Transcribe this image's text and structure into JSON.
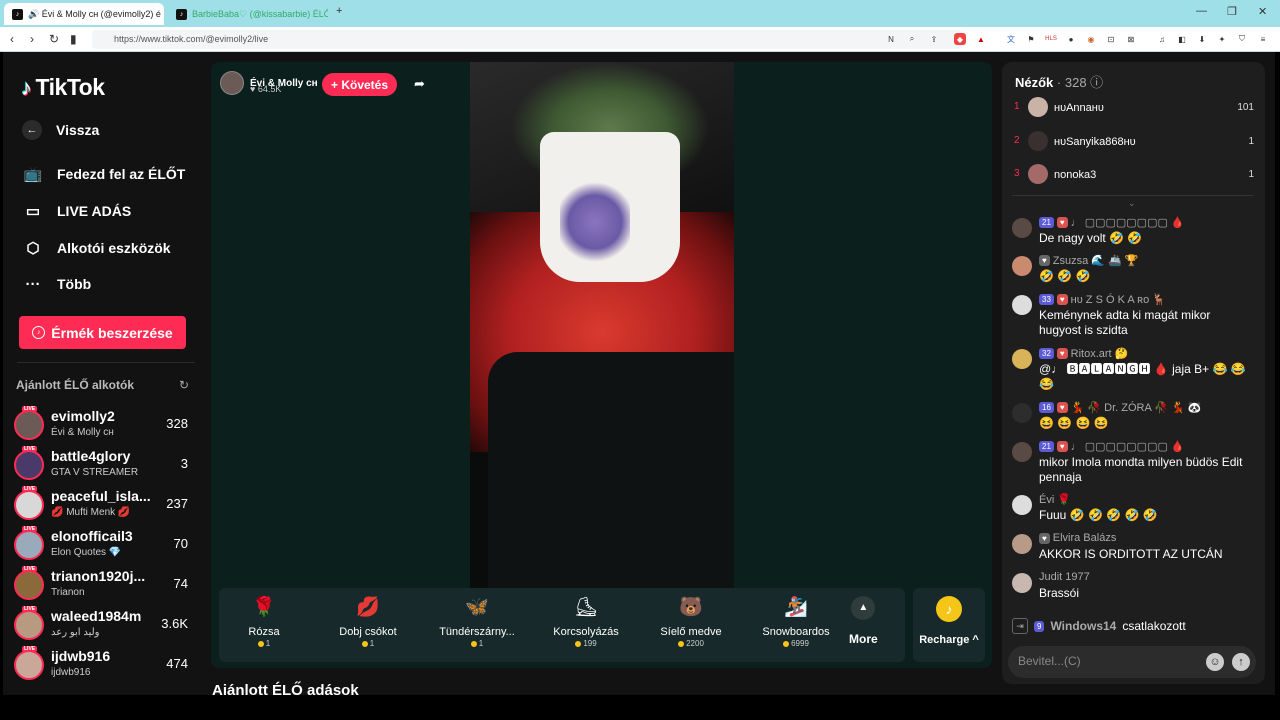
{
  "browser": {
    "tabs": [
      {
        "title": "🔊 Évi & Molly ᴄʜ (@evimolly2) é"
      },
      {
        "title": "BarbieBaba♡ (@kissabarbie) ÉLŐ ad"
      }
    ],
    "url": "https://www.tiktok.com/@evimolly2/live"
  },
  "sidebar": {
    "logo": "TikTok",
    "back": "Vissza",
    "nav": [
      {
        "label": "Fedezd fel az ÉLŐT",
        "icon": "tv-icon"
      },
      {
        "label": "LIVE ADÁS",
        "icon": "camera-icon"
      },
      {
        "label": "Alkotói eszközök",
        "icon": "creator-tools-icon"
      },
      {
        "label": "Több",
        "icon": "more-icon"
      }
    ],
    "coins_button": "Érmék beszerzése",
    "recommended_title": "Ajánlott ÉLŐ alkotók",
    "creators": [
      {
        "name": "evimolly2",
        "sub": "Évi & Molly ᴄʜ",
        "count": "328"
      },
      {
        "name": "battle4glory",
        "sub": "GTA V STREAMER",
        "count": "3"
      },
      {
        "name": "peaceful_isla...",
        "sub": "💋 Mufti Menk 💋",
        "count": "237"
      },
      {
        "name": "elonofficail3",
        "sub": "Elon Quotes 💎",
        "count": "70"
      },
      {
        "name": "trianon1920j...",
        "sub": "Trianon",
        "count": "74"
      },
      {
        "name": "waleed1984m",
        "sub": "وليد ابو رعد",
        "count": "3.6K"
      },
      {
        "name": "ijdwb916",
        "sub": "ijdwb916",
        "count": "474"
      }
    ],
    "live_badge": "LIVE"
  },
  "stream": {
    "host_name": "Évi & Molly ᴄʜ",
    "host_likes": "♥ 64.5K",
    "follow": "+ Követés",
    "gifts": [
      {
        "name": "Rózsa",
        "price": "1",
        "emoji": "🌹"
      },
      {
        "name": "Dobj csókot",
        "price": "1",
        "emoji": "💋"
      },
      {
        "name": "Tündérszárny...",
        "price": "1",
        "emoji": "🦋"
      },
      {
        "name": "Korcsolyázás",
        "price": "199",
        "emoji": "⛸"
      },
      {
        "name": "Síelő medve",
        "price": "2200",
        "emoji": "🐻"
      },
      {
        "name": "Snowboardos",
        "price": "6999",
        "emoji": "🏂"
      }
    ],
    "more": "More",
    "recharge": "Recharge ^",
    "recommended_live": "Ajánlott ÉLŐ adások"
  },
  "chat": {
    "viewers_title": "Nézők",
    "viewers_count": "· 328 ⓘ",
    "top_viewers": [
      {
        "rank": "1",
        "name": "ʜᴜAnnaʜᴜ",
        "score": "101"
      },
      {
        "rank": "2",
        "name": "ʜᴜSanyika868ʜᴜ",
        "score": "1"
      },
      {
        "rank": "3",
        "name": "nonoka3",
        "score": "1"
      }
    ],
    "messages": [
      {
        "level": "21",
        "user": "♩ ▢▢▢▢▢▢▢▢ 🩸",
        "text": "De nagy volt 🤣 🤣"
      },
      {
        "level": "",
        "user": "Zsuzsa 🌊 🚢 🏆",
        "text": "🤣 🤣 🤣"
      },
      {
        "level": "33",
        "user": "ʜᴜ Z S Ó K A ʀᴏ 🦌",
        "text": "Keménynek adta ki magát mikor hugyost is szidta"
      },
      {
        "level": "32",
        "user": "Ritox.art 🤔",
        "text": "@♩ 🅱🅰🅻🅰🅽🅶🅷 🩸 jaja B+ 😂 😂 😂"
      },
      {
        "level": "16",
        "user": "💃 🥀 Dr. ZÓRA 🥀 💃 🐼",
        "text": "😆 😆 😆 😆"
      },
      {
        "level": "21",
        "user": "♩ ▢▢▢▢▢▢▢▢ 🩸",
        "text": "mikor Imola mondta milyen büdös Edit pennaja"
      },
      {
        "level": "",
        "user": "Évi 🌹",
        "text": "Fuuu 🤣 🤣 🤣 🤣 🤣"
      },
      {
        "level": "",
        "user": "Elvira Balázs",
        "text": "AKKOR IS ORDITOTT AZ UTCÁN"
      },
      {
        "level": "",
        "user": "Judit 1977",
        "text": "Brassói"
      }
    ],
    "join": {
      "level": "9",
      "user": "Windows14",
      "text": "csatlakozott"
    },
    "input_placeholder": "Bevitel...(C)"
  }
}
